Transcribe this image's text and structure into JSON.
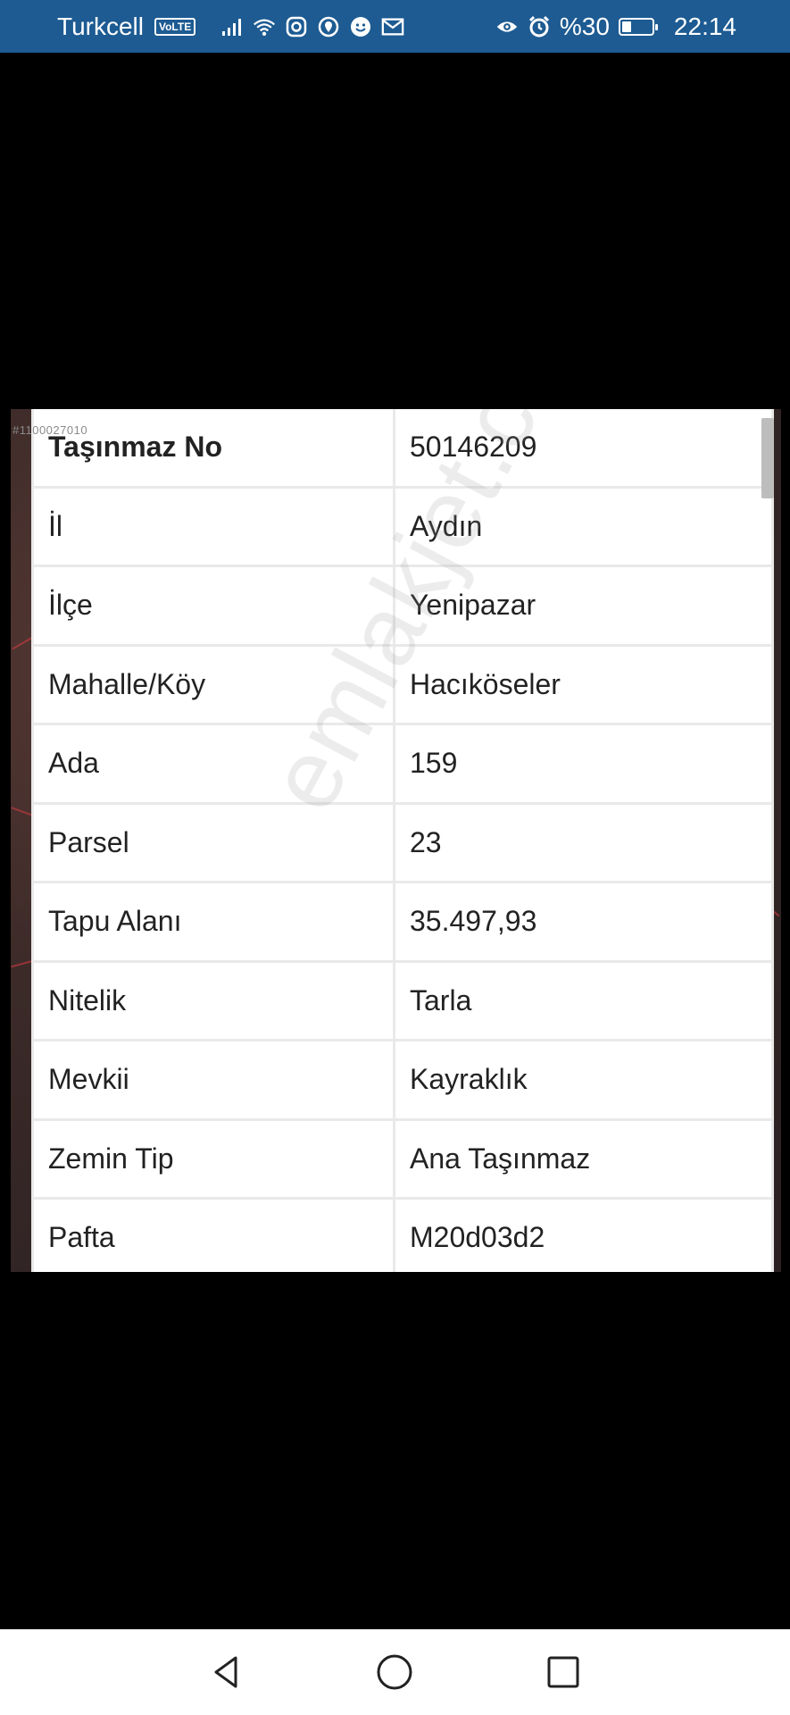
{
  "status_bar": {
    "carrier": "Turkcell",
    "volte": "VoLTE",
    "battery_percent": "%30",
    "battery_level": 0.3,
    "time": "22:14"
  },
  "photo": {
    "watermark_code": "#1100027010",
    "watermark_text": "emlakjet.com"
  },
  "property_table": {
    "rows": [
      {
        "label": "Taşınmaz No",
        "value": "50146209"
      },
      {
        "label": "İl",
        "value": "Aydın"
      },
      {
        "label": "İlçe",
        "value": "Yenipazar"
      },
      {
        "label": "Mahalle/Köy",
        "value": "Hacıköseler"
      },
      {
        "label": "Ada",
        "value": "159"
      },
      {
        "label": "Parsel",
        "value": "23"
      },
      {
        "label": "Tapu Alanı",
        "value": "35.497,93"
      },
      {
        "label": "Nitelik",
        "value": "Tarla"
      },
      {
        "label": "Mevkii",
        "value": "Kayraklık"
      },
      {
        "label": "Zemin Tip",
        "value": "Ana Taşınmaz"
      },
      {
        "label": "Pafta",
        "value": "M20d03d2"
      }
    ]
  },
  "nav_bar": {
    "buttons": [
      "back-icon",
      "home-icon",
      "recents-icon"
    ]
  },
  "colors": {
    "status_bar_bg": "#1d5b92",
    "screen_bg": "#000000",
    "table_grid": "#e9e9e9"
  }
}
